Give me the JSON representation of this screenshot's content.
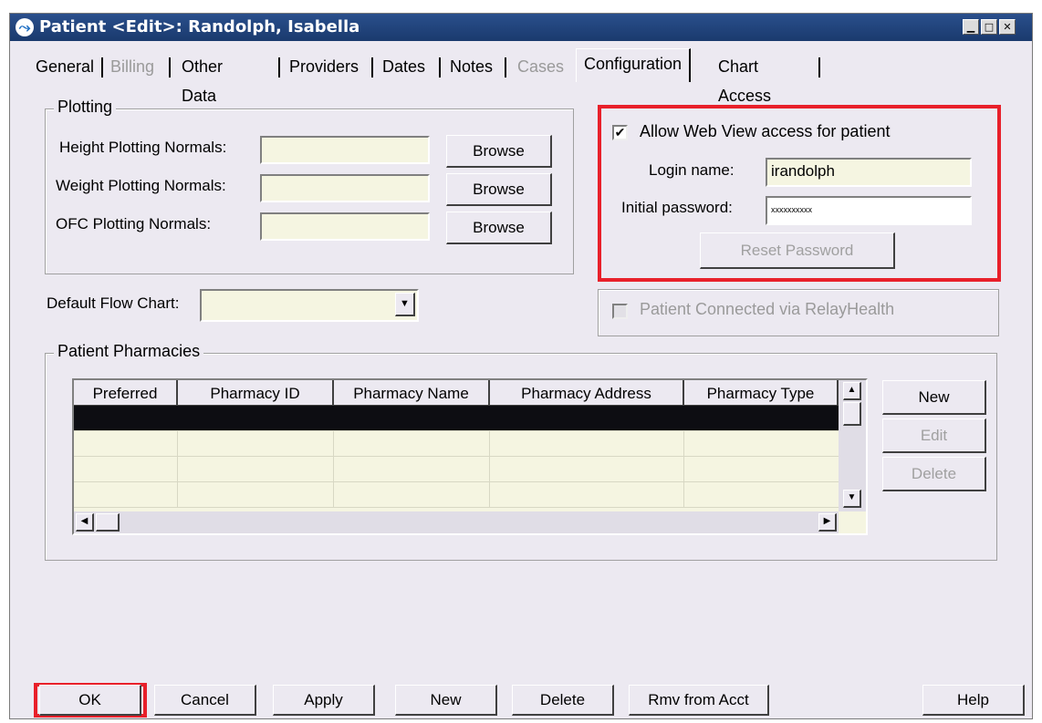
{
  "window": {
    "title": "Patient <Edit>: Randolph, Isabella",
    "icon": "app-logo-icon"
  },
  "tabs": [
    {
      "label": "General",
      "state": "enabled"
    },
    {
      "label": "Billing",
      "state": "disabled"
    },
    {
      "label": "Other Data",
      "state": "enabled"
    },
    {
      "label": "Providers",
      "state": "enabled"
    },
    {
      "label": "Dates",
      "state": "enabled"
    },
    {
      "label": "Notes",
      "state": "enabled"
    },
    {
      "label": "Cases",
      "state": "disabled"
    },
    {
      "label": "Configuration",
      "state": "active"
    },
    {
      "label": "Chart Access",
      "state": "enabled"
    }
  ],
  "plotting": {
    "legend": "Plotting",
    "height_label": "Height Plotting Normals:",
    "weight_label": "Weight Plotting Normals:",
    "ofc_label": "OFC Plotting Normals:",
    "browse_label": "Browse",
    "height_value": "",
    "weight_value": "",
    "ofc_value": ""
  },
  "flow_chart": {
    "label": "Default Flow Chart:",
    "value": ""
  },
  "web_view": {
    "allow_label": "Allow Web View access for patient",
    "allow_checked": true,
    "login_label": "Login name:",
    "login_value": "irandolph",
    "password_label": "Initial password:",
    "password_value": "xxxxxxxxxx",
    "reset_label": "Reset Password"
  },
  "relay": {
    "label": "Patient Connected via RelayHealth",
    "checked": false
  },
  "pharmacies": {
    "legend": "Patient Pharmacies",
    "columns": [
      "Preferred",
      "Pharmacy ID",
      "Pharmacy Name",
      "Pharmacy Address",
      "Pharmacy Type"
    ],
    "rows": [],
    "new_label": "New",
    "edit_label": "Edit",
    "delete_label": "Delete"
  },
  "footer": {
    "ok": "OK",
    "cancel": "Cancel",
    "apply": "Apply",
    "new": "New",
    "delete": "Delete",
    "rmv": "Rmv from Acct",
    "help": "Help"
  },
  "colors": {
    "highlight": "#e8202a",
    "field_bg": "#f5f5e1",
    "title_bg": "#1a3a6e"
  }
}
